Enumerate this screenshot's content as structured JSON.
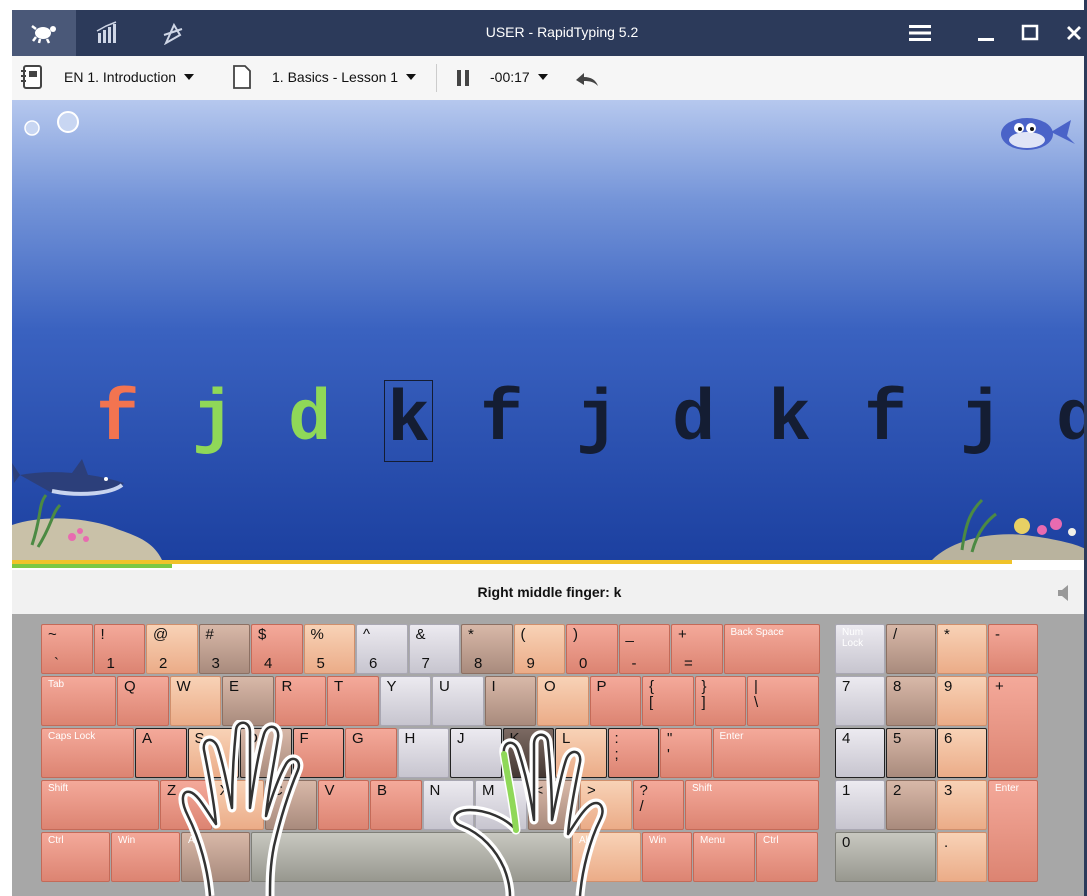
{
  "window": {
    "title": "USER - RapidTyping 5.2"
  },
  "toolbar": {
    "course": "EN 1. Introduction",
    "lesson": "1. Basics - Lesson 1",
    "timer": "-00:17"
  },
  "exercise": {
    "letters": [
      "f",
      "j",
      "d",
      "k",
      "f",
      "j",
      "d",
      "k",
      "f",
      "j",
      "d"
    ],
    "typed_count": 3,
    "current_index": 3,
    "progress": 0.16
  },
  "hint": {
    "text": "Right middle finger: k"
  },
  "keyboard": {
    "row1": [
      {
        "top": "~",
        "bottom": "`"
      },
      {
        "top": "!",
        "bottom": "1"
      },
      {
        "top": "@",
        "bottom": "2"
      },
      {
        "top": "#",
        "bottom": "3"
      },
      {
        "top": "$",
        "bottom": "4"
      },
      {
        "top": "%",
        "bottom": "5"
      },
      {
        "top": "^",
        "bottom": "6"
      },
      {
        "top": "&",
        "bottom": "7"
      },
      {
        "top": "*",
        "bottom": "8"
      },
      {
        "top": "(",
        "bottom": "9"
      },
      {
        "top": ")",
        "bottom": "0"
      },
      {
        "top": "_",
        "bottom": "-"
      },
      {
        "top": "+",
        "bottom": "="
      },
      {
        "top": "Back Space",
        "bottom": ""
      }
    ],
    "row2": [
      "Tab",
      "Q",
      "W",
      "E",
      "R",
      "T",
      "Y",
      "U",
      "I",
      "O",
      "P",
      "{\n[",
      "}\n]",
      "|\n\\"
    ],
    "row3": [
      "Caps Lock",
      "A",
      "S",
      "D",
      "F",
      "G",
      "H",
      "J",
      "K",
      "L",
      ":\n;",
      "\"\n'",
      "Enter"
    ],
    "row4": [
      "Shift",
      "Z",
      "X",
      "C",
      "V",
      "B",
      "N",
      "M",
      "<\n,",
      ">\n.",
      "?\n/",
      "Shift"
    ],
    "row5": [
      "Ctrl",
      "Win",
      "Alt",
      "",
      "Alt",
      "Win",
      "Menu",
      "Ctrl"
    ],
    "numpad": [
      "Num\nLock",
      "/",
      "*",
      "-",
      "7",
      "8",
      "9",
      "+",
      "4",
      "5",
      "6",
      "1",
      "2",
      "3",
      "Enter",
      "0",
      "."
    ]
  },
  "colors": {
    "titlebar": "#2c3a5a",
    "typed_letter": "#f37450",
    "correct_letter": "#8fd858",
    "pending_letter": "#141d33"
  }
}
